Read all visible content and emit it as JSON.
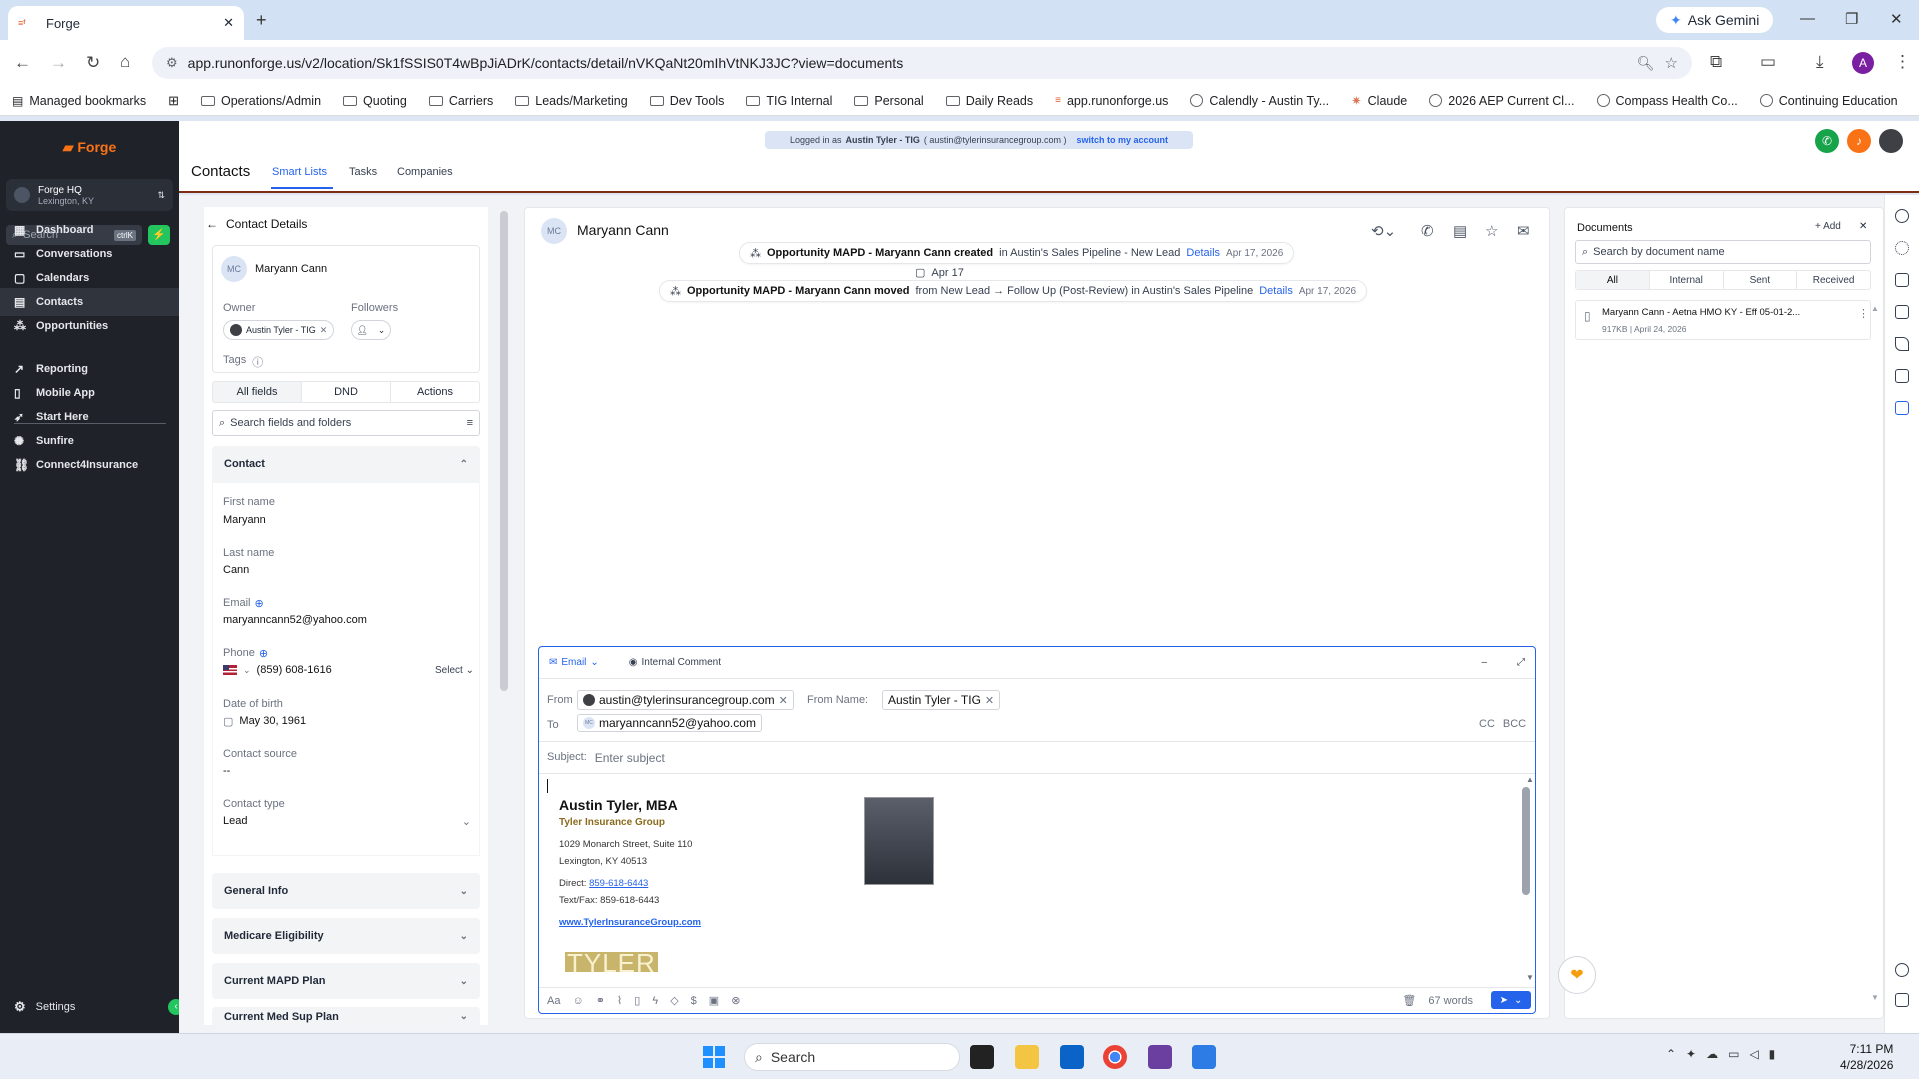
{
  "browser": {
    "tab_title": "Forge",
    "tab_favicon": "forge",
    "new_tab": "+",
    "ask_gemini": "Ask Gemini",
    "url": "app.runonforge.us/v2/location/Sk1fSSIS0T4wBpJiADrK/contacts/detail/nVKQaNt20mIhVtNKJ3JC?view=documents",
    "profile_initial": "A",
    "bookmarks": [
      {
        "label": "Managed bookmarks",
        "icon": "managed-bookmarks-icon"
      },
      {
        "label": "Operations/Admin",
        "icon": "folder-icon"
      },
      {
        "label": "Quoting",
        "icon": "folder-icon"
      },
      {
        "label": "Carriers",
        "icon": "folder-icon"
      },
      {
        "label": "Leads/Marketing",
        "icon": "folder-icon"
      },
      {
        "label": "Dev Tools",
        "icon": "folder-icon"
      },
      {
        "label": "TIG Internal",
        "icon": "folder-icon"
      },
      {
        "label": "Personal",
        "icon": "folder-icon"
      },
      {
        "label": "Daily Reads",
        "icon": "folder-icon"
      },
      {
        "label": "app.runonforge.us",
        "icon": "forge-icon"
      },
      {
        "label": "Calendly - Austin Ty...",
        "icon": "globe-icon"
      },
      {
        "label": "Claude",
        "icon": "claude-icon"
      },
      {
        "label": "2026 AEP Current Cl...",
        "icon": "globe-icon"
      },
      {
        "label": "Compass Health Co...",
        "icon": "globe-icon"
      },
      {
        "label": "Continuing Education",
        "icon": "globe-icon"
      }
    ]
  },
  "sidebar": {
    "brand": "Forge",
    "location_name": "Forge HQ",
    "location_sub": "Lexington, KY",
    "search_placeholder": "Search",
    "search_shortcut": "ctrlK",
    "nav_main": [
      {
        "label": "Dashboard",
        "icon": "dashboard-icon",
        "active": false
      },
      {
        "label": "Conversations",
        "icon": "chat-icon",
        "active": false
      },
      {
        "label": "Calendars",
        "icon": "calendar-icon",
        "active": false
      },
      {
        "label": "Contacts",
        "icon": "contacts-icon",
        "active": true
      },
      {
        "label": "Opportunities",
        "icon": "opportunities-icon",
        "active": false
      }
    ],
    "nav_secondary": [
      {
        "label": "Reporting",
        "icon": "chart-icon"
      },
      {
        "label": "Mobile App",
        "icon": "phone-icon"
      },
      {
        "label": "Start Here",
        "icon": "rocket-icon"
      },
      {
        "label": "Sunfire",
        "icon": "sun-icon"
      },
      {
        "label": "Connect4Insurance",
        "icon": "link-icon"
      }
    ],
    "settings": "Settings"
  },
  "header": {
    "impersonation_prefix": "Logged in as",
    "impersonation_user": "Austin Tyler - TIG",
    "impersonation_email": "( austin@tylerinsurancegroup.com )",
    "switch_link": "switch to my account",
    "title": "Contacts",
    "tabs": [
      "Smart Lists",
      "Tasks",
      "Companies"
    ],
    "active_tab": "Smart Lists"
  },
  "contact_panel": {
    "back_title": "Contact Details",
    "avatar_initials": "MC",
    "name": "Maryann Cann",
    "owner_label": "Owner",
    "owner_value": "Austin Tyler - TIG",
    "followers_label": "Followers",
    "tags_label": "Tags",
    "segments": [
      "All fields",
      "DND",
      "Actions"
    ],
    "search_placeholder": "Search fields and folders",
    "section_contact": "Contact",
    "fields": {
      "first_name_label": "First name",
      "first_name": "Maryann",
      "last_name_label": "Last name",
      "last_name": "Cann",
      "email_label": "Email",
      "email": "maryanncann52@yahoo.com",
      "phone_label": "Phone",
      "phone": "(859) 608-1616",
      "phone_select": "Select",
      "dob_label": "Date of birth",
      "dob": "May 30, 1961",
      "source_label": "Contact source",
      "source": "--",
      "type_label": "Contact type",
      "type": "Lead"
    },
    "sections": [
      "General Info",
      "Medicare Eligibility",
      "Current MAPD Plan",
      "Current Med Sup Plan"
    ]
  },
  "timeline": {
    "avatar_initials": "MC",
    "contact_name": "Maryann Cann",
    "date_divider": "Apr 17",
    "events": [
      {
        "lead": "Opportunity MAPD - Maryann Cann created",
        "rest": "in Austin's Sales Pipeline - New Lead",
        "link": "Details",
        "date": "Apr 17, 2026"
      },
      {
        "lead": "Opportunity MAPD - Maryann Cann moved",
        "rest": "from New Lead → Follow Up (Post-Review) in Austin's Sales Pipeline",
        "link": "Details",
        "date": "Apr 17, 2026"
      }
    ]
  },
  "composer": {
    "tab_email": "Email",
    "tab_comment": "Internal Comment",
    "from_label": "From",
    "from_email": "austin@tylerinsurancegroup.com",
    "from_name_label": "From Name:",
    "from_name": "Austin Tyler - TIG",
    "to_label": "To",
    "to_initials": "MC",
    "to_email": "maryanncann52@yahoo.com",
    "cc": "CC",
    "bcc": "BCC",
    "subject_label": "Subject:",
    "subject_placeholder": "Enter subject",
    "signature": {
      "name": "Austin Tyler, MBA",
      "company": "Tyler Insurance Group",
      "address1": "1029 Monarch Street, Suite 110",
      "address2": "Lexington, KY 40513",
      "direct_label": "Direct:",
      "direct": "859-618-6443",
      "textfax": "Text/Fax: 859-618-6443",
      "website": "www.TylerInsuranceGroup.com",
      "logo_text": "TYLER"
    },
    "word_count": "67 words"
  },
  "documents": {
    "title": "Documents",
    "add": "Add",
    "search_placeholder": "Search by document name",
    "filters": [
      "All",
      "Internal",
      "Sent",
      "Received"
    ],
    "items": [
      {
        "name": "Maryann Cann - Aetna HMO KY - Eff 05-01-2...",
        "meta": "917KB | April 24, 2026"
      }
    ]
  },
  "taskbar": {
    "search_placeholder": "Search",
    "time": "7:11 PM",
    "date": "4/28/2026"
  }
}
